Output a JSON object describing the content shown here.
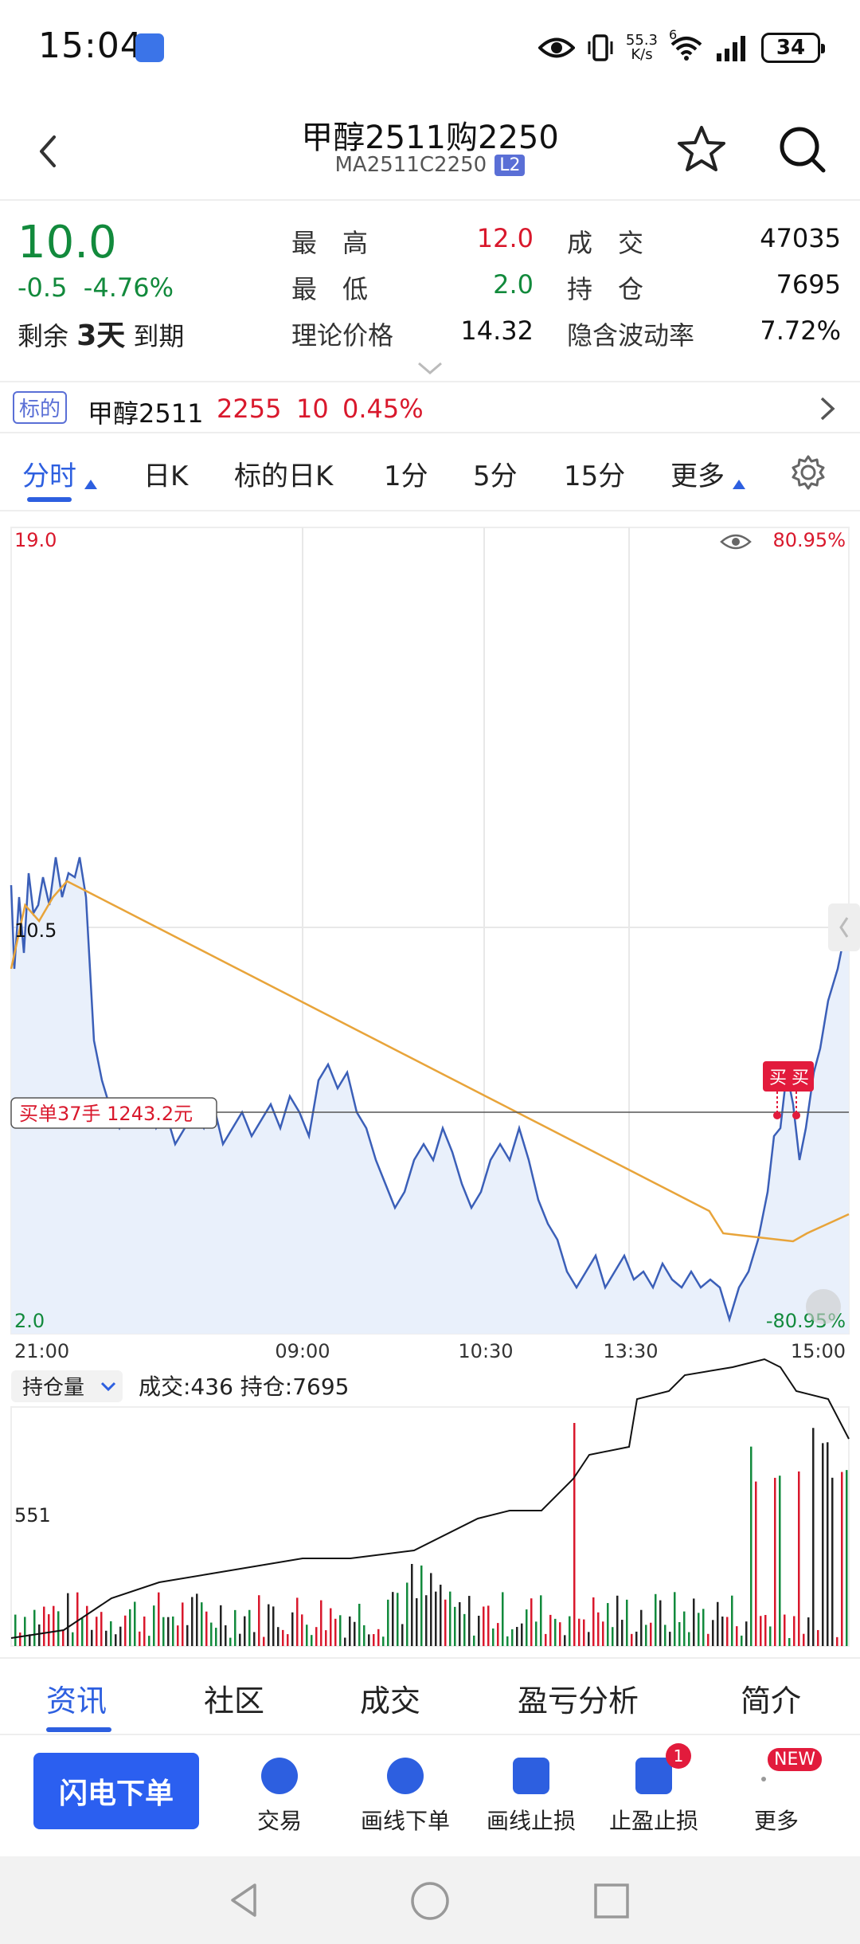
{
  "status": {
    "time": "15:04",
    "net_speed_value": "55.3",
    "net_speed_unit": "K/s",
    "network_gen": "6",
    "battery": "34",
    "icons": [
      "eye-icon",
      "vibrate-icon",
      "wifi-icon",
      "signal-icon",
      "battery-icon"
    ]
  },
  "header": {
    "title": "甲醇2511购2250",
    "code": "MA2511C2250",
    "badge": "L2",
    "icons": [
      "back-chevron-icon",
      "star-icon",
      "search-icon"
    ]
  },
  "quote": {
    "last": "10.0",
    "change": "-0.5",
    "change_pct": "-4.76%",
    "remaining_label": "剩余",
    "remaining_days": "3天",
    "expire_label": "到期",
    "rows": [
      {
        "l1": "最　高",
        "v1": "12.0",
        "l2": "成　交",
        "v2": "47035"
      },
      {
        "l1": "最　低",
        "v1": "2.0",
        "l2": "持　仓",
        "v2": "7695"
      },
      {
        "l1": "理论价格",
        "v1": "14.32",
        "l2": "隐含波动率",
        "v2": "7.72%"
      }
    ]
  },
  "underlying": {
    "tag": "标的",
    "name": "甲醇2511",
    "price": "2255",
    "change": "10",
    "pct": "0.45%"
  },
  "tabs": [
    "分时",
    "日K",
    "标的日K",
    "1分",
    "5分",
    "15分",
    "更多"
  ],
  "chart": {
    "y_top": "19.0",
    "y_mid": "10.5",
    "y_bottom": "2.0",
    "pct_top": "80.95%",
    "pct_bottom": "-80.95%",
    "x_labels": [
      "21:00",
      "09:00",
      "10:30",
      "13:30",
      "15:00"
    ],
    "order_label": "买单37手  1243.2元",
    "buy_badges": [
      "买",
      "买"
    ],
    "volume_selector": "持仓量",
    "volume_info": "成交:436  持仓:7695",
    "volume_axis": "551"
  },
  "chart_data": {
    "type": "line",
    "title": "",
    "xlabel": "",
    "ylabel": "",
    "ylim": [
      2.0,
      19.0
    ],
    "x": [
      "21:00",
      "09:00",
      "10:30",
      "13:30",
      "15:00"
    ],
    "series": [
      {
        "name": "",
        "values": [
          10.5,
          7.2,
          7.0,
          6.0,
          4.0,
          3.5,
          11.0
        ]
      },
      {
        "name": "",
        "values": [
          9.8,
          8.8,
          8.1,
          7.4,
          6.8,
          6.2,
          6.7
        ]
      }
    ]
  },
  "info_tabs": [
    "资讯",
    "社区",
    "成交",
    "盈亏分析",
    "简介"
  ],
  "actions": {
    "flash": "闪电下单",
    "items": [
      {
        "label": "交易"
      },
      {
        "label": "画线下单"
      },
      {
        "label": "画线止损"
      },
      {
        "label": "止盈止损",
        "badge": "1"
      },
      {
        "label": "更多",
        "badge": "NEW"
      }
    ]
  },
  "colors": {
    "accent": "#2d5fe0",
    "up": "#d9182c",
    "down": "#128a3c",
    "price_line": "#3b5fb8",
    "avg_line": "#e8a43a"
  }
}
